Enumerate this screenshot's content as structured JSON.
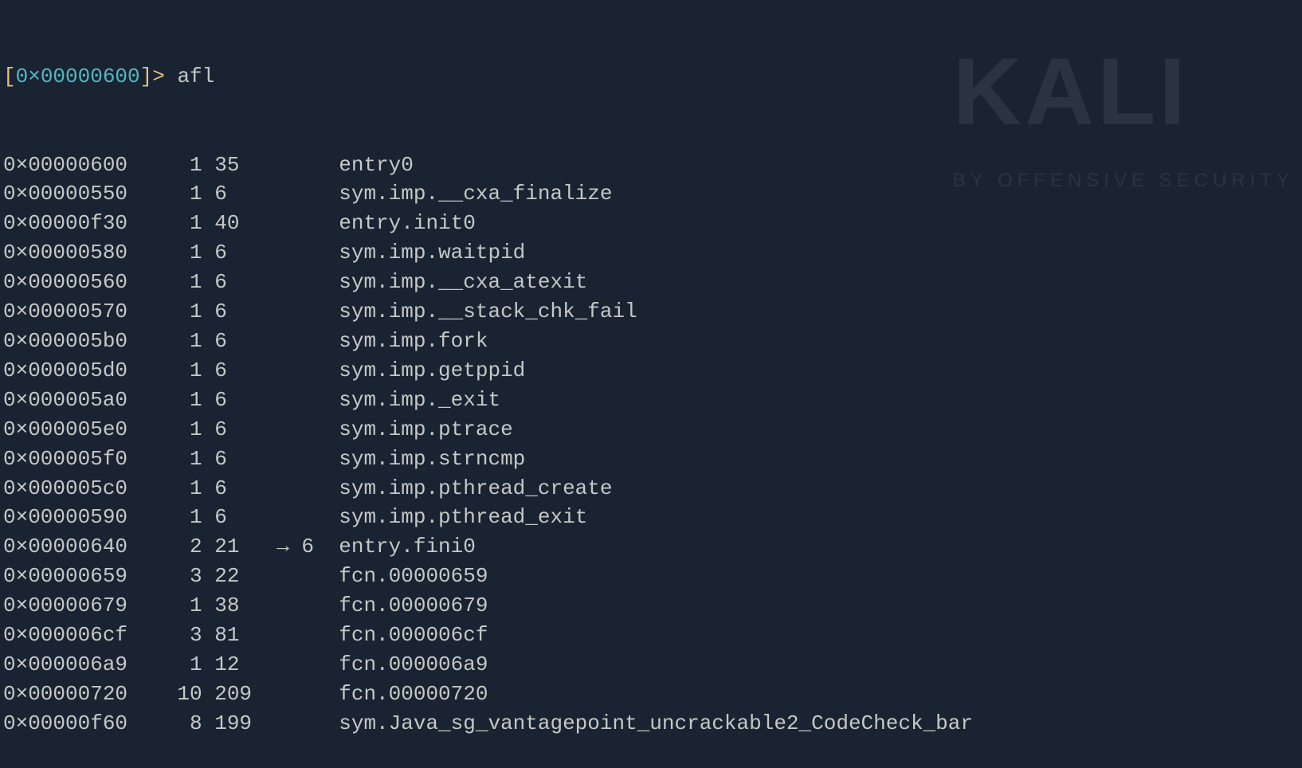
{
  "watermark": {
    "main": "KALI",
    "sub": "BY OFFENSIVE SECURITY"
  },
  "prompt": {
    "open": "[",
    "addr": "0×00000600",
    "close": "]> ",
    "command": "afl"
  },
  "rows": [
    {
      "addr": "0×00000600",
      "bb": "1",
      "sz": "35",
      "arrow": "",
      "name": "entry0"
    },
    {
      "addr": "0×00000550",
      "bb": "1",
      "sz": "6",
      "arrow": "",
      "name": "sym.imp.__cxa_finalize"
    },
    {
      "addr": "0×00000f30",
      "bb": "1",
      "sz": "40",
      "arrow": "",
      "name": "entry.init0"
    },
    {
      "addr": "0×00000580",
      "bb": "1",
      "sz": "6",
      "arrow": "",
      "name": "sym.imp.waitpid"
    },
    {
      "addr": "0×00000560",
      "bb": "1",
      "sz": "6",
      "arrow": "",
      "name": "sym.imp.__cxa_atexit"
    },
    {
      "addr": "0×00000570",
      "bb": "1",
      "sz": "6",
      "arrow": "",
      "name": "sym.imp.__stack_chk_fail"
    },
    {
      "addr": "0×000005b0",
      "bb": "1",
      "sz": "6",
      "arrow": "",
      "name": "sym.imp.fork"
    },
    {
      "addr": "0×000005d0",
      "bb": "1",
      "sz": "6",
      "arrow": "",
      "name": "sym.imp.getppid"
    },
    {
      "addr": "0×000005a0",
      "bb": "1",
      "sz": "6",
      "arrow": "",
      "name": "sym.imp._exit"
    },
    {
      "addr": "0×000005e0",
      "bb": "1",
      "sz": "6",
      "arrow": "",
      "name": "sym.imp.ptrace"
    },
    {
      "addr": "0×000005f0",
      "bb": "1",
      "sz": "6",
      "arrow": "",
      "name": "sym.imp.strncmp"
    },
    {
      "addr": "0×000005c0",
      "bb": "1",
      "sz": "6",
      "arrow": "",
      "name": "sym.imp.pthread_create"
    },
    {
      "addr": "0×00000590",
      "bb": "1",
      "sz": "6",
      "arrow": "",
      "name": "sym.imp.pthread_exit"
    },
    {
      "addr": "0×00000640",
      "bb": "2",
      "sz": "21",
      "arrow": " → 6",
      "name": "entry.fini0"
    },
    {
      "addr": "0×00000659",
      "bb": "3",
      "sz": "22",
      "arrow": "",
      "name": "fcn.00000659"
    },
    {
      "addr": "0×00000679",
      "bb": "1",
      "sz": "38",
      "arrow": "",
      "name": "fcn.00000679"
    },
    {
      "addr": "0×000006cf",
      "bb": "3",
      "sz": "81",
      "arrow": "",
      "name": "fcn.000006cf"
    },
    {
      "addr": "0×000006a9",
      "bb": "1",
      "sz": "12",
      "arrow": "",
      "name": "fcn.000006a9"
    },
    {
      "addr": "0×00000720",
      "bb": "10",
      "sz": "209",
      "arrow": "",
      "name": "fcn.00000720"
    },
    {
      "addr": "0×00000f60",
      "bb": "8",
      "sz": "199",
      "arrow": "",
      "name": "sym.Java_sg_vantagepoint_uncrackable2_CodeCheck_bar"
    }
  ]
}
